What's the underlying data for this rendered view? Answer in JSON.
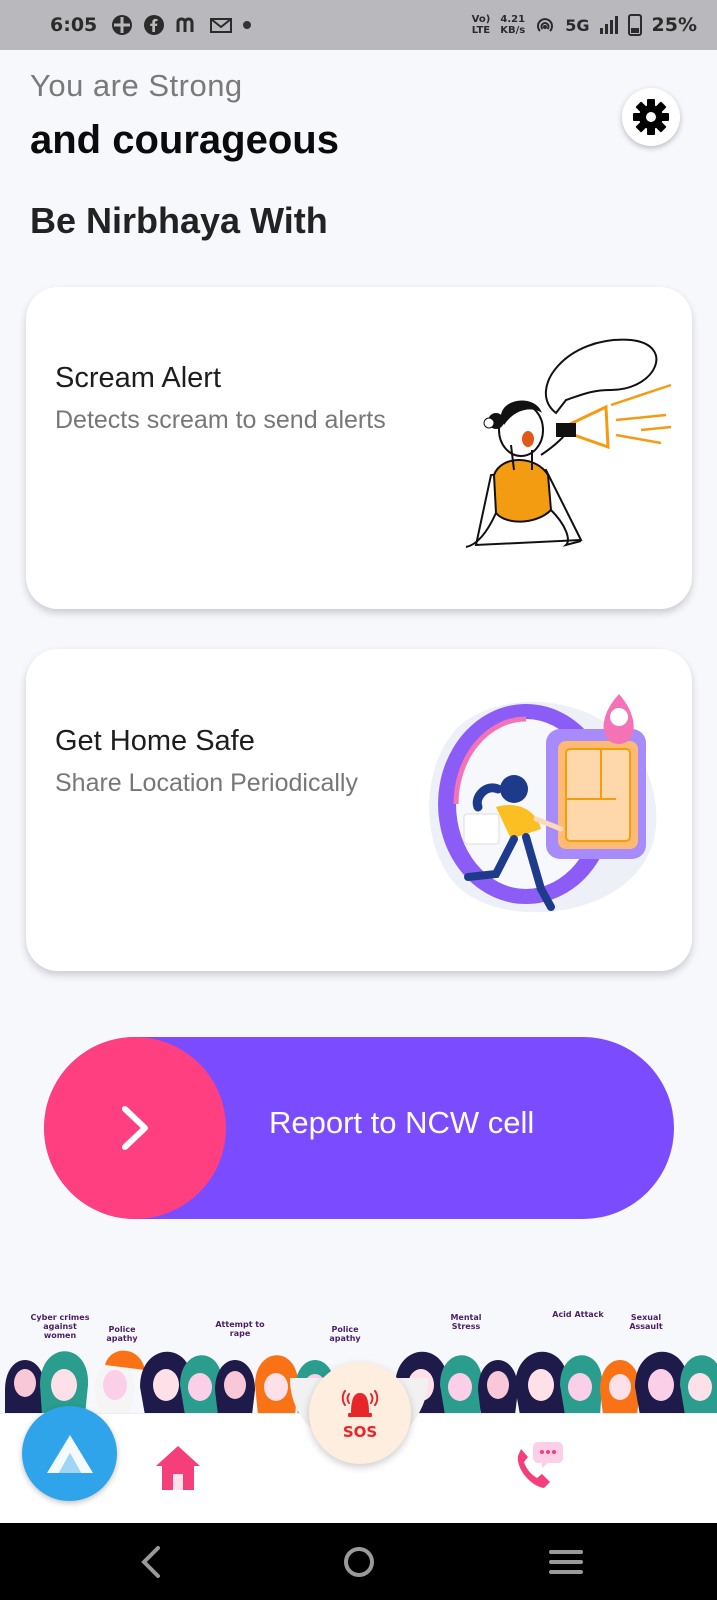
{
  "status_bar": {
    "time": "6:05",
    "network_top": "Vo)",
    "network_bottom": "LTE",
    "speed_value": "4.21",
    "speed_unit": "KB/s",
    "signal": "5G",
    "battery": "25%"
  },
  "header": {
    "greeting_line1": "You are Strong",
    "greeting_line2": "and courageous",
    "section_title": "Be Nirbhaya With"
  },
  "features": [
    {
      "title": "Scream Alert",
      "description": "Detects scream to send alerts"
    },
    {
      "title": "Get Home Safe",
      "description": "Share Location Periodically"
    }
  ],
  "report": {
    "label": "Report to NCW cell"
  },
  "banner": {
    "tags": [
      "Cyber crimes against women",
      "Police apathy",
      "Attempt to rape",
      "Police apathy",
      "Mental Stress",
      "Acid Attack",
      "Sexual Assault"
    ]
  },
  "bottom_nav": {
    "sos_label": "SOS"
  },
  "colors": {
    "accent_purple": "#7b4bff",
    "accent_pink": "#ff3f80",
    "sos_red": "#e8262a",
    "fab_blue": "#2fa4ea"
  }
}
